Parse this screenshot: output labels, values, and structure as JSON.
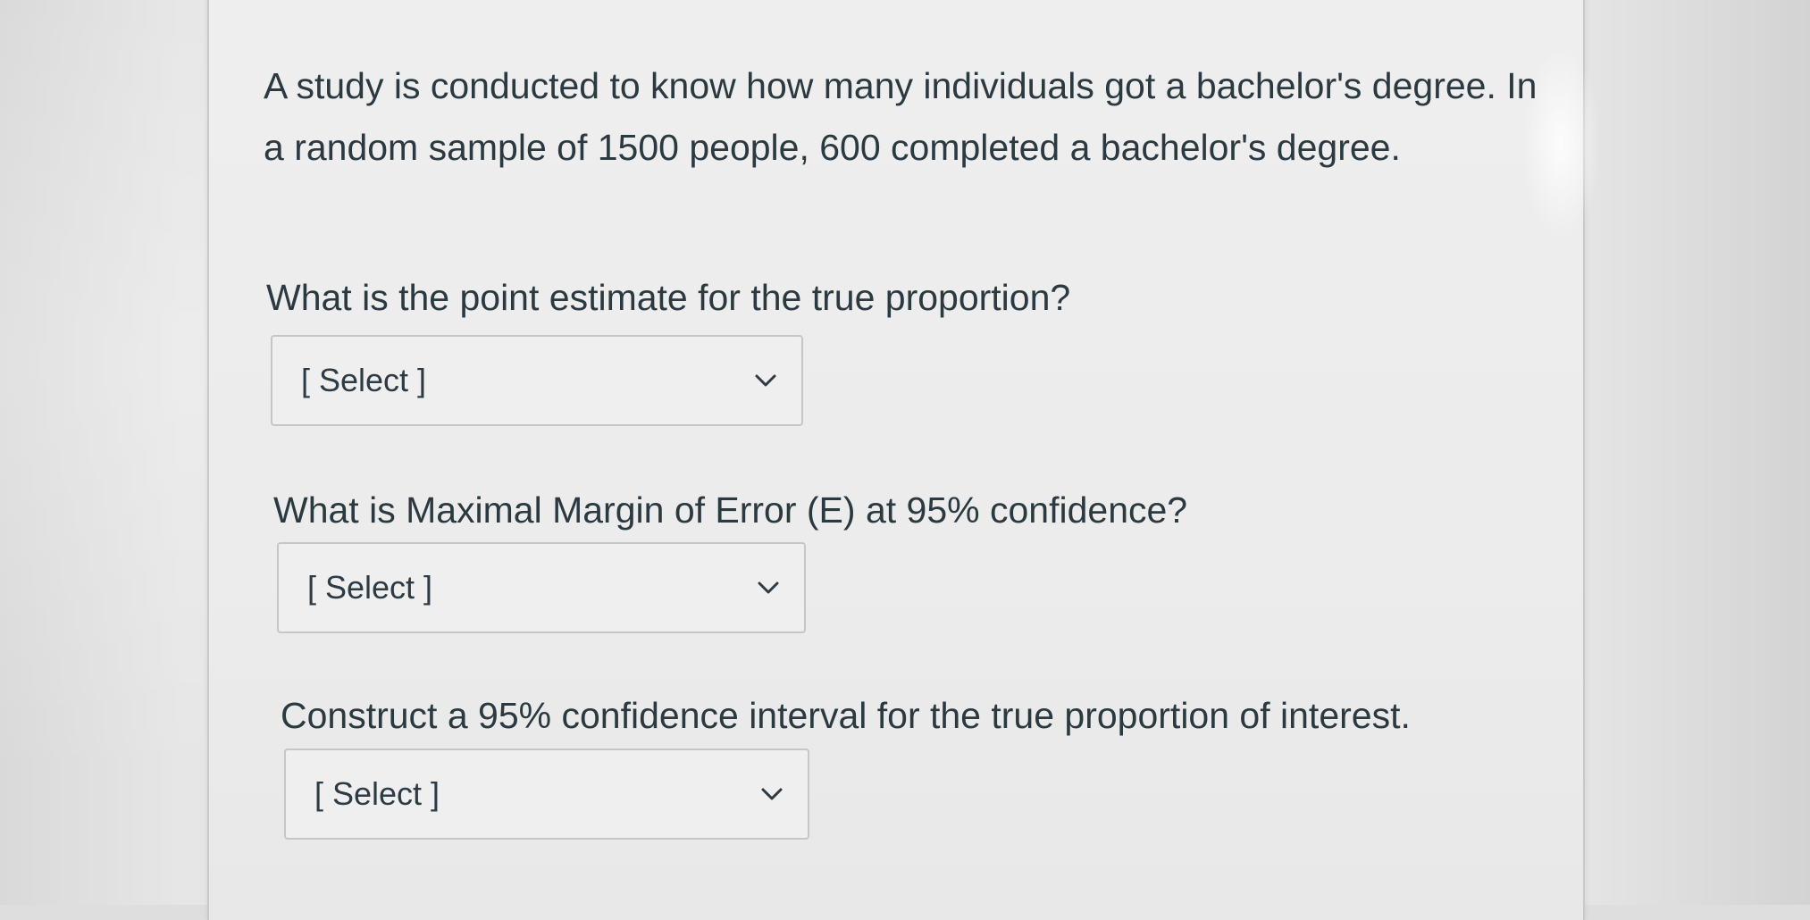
{
  "question": {
    "stem": "A study is conducted to know how many individuals got a bachelor's degree. In a random sample of 1500 people, 600 completed a bachelor's degree.",
    "parts": [
      {
        "prompt": "What is the point estimate for the true proportion?",
        "dropdown": {
          "selected": "[ Select ]",
          "icon": "chevron-down-icon"
        }
      },
      {
        "prompt": "What is Maximal Margin of Error (E) at 95% confidence?",
        "dropdown": {
          "selected": "[ Select ]",
          "icon": "chevron-down-icon"
        }
      },
      {
        "prompt": "Construct a 95% confidence interval for the true proportion of interest.",
        "dropdown": {
          "selected": "[ Select ]",
          "icon": "chevron-down-icon"
        }
      }
    ]
  },
  "colors": {
    "text": "#2b3940",
    "select_border": "#c4c7ca",
    "card_background": "#eeeeee"
  }
}
